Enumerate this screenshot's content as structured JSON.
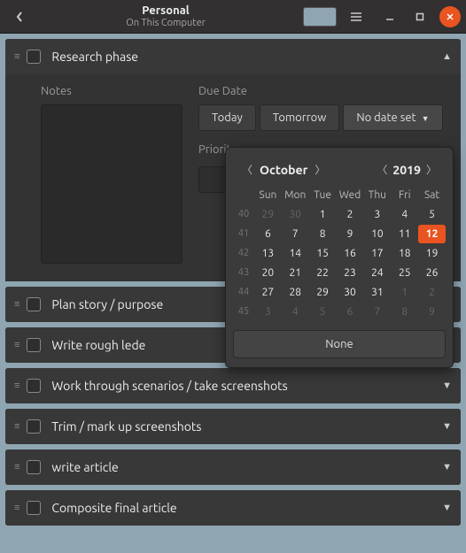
{
  "titlebar": {
    "title": "Personal",
    "subtitle": "On This Computer",
    "color_swatch": "#8fa6b2"
  },
  "expanded_task": {
    "title": "Research phase",
    "notes_label": "Notes",
    "due_label": "Due Date",
    "due_buttons": {
      "today": "Today",
      "tomorrow": "Tomorrow",
      "none": "No date set"
    },
    "priority_label": "Priority"
  },
  "calendar": {
    "month": "October",
    "year": "2019",
    "dow": [
      "Sun",
      "Mon",
      "Tue",
      "Wed",
      "Thu",
      "Fri",
      "Sat"
    ],
    "weeks": [
      {
        "wk": 40,
        "days": [
          {
            "n": 29,
            "out": true
          },
          {
            "n": 30,
            "out": true
          },
          {
            "n": 1
          },
          {
            "n": 2
          },
          {
            "n": 3
          },
          {
            "n": 4
          },
          {
            "n": 5
          }
        ]
      },
      {
        "wk": 41,
        "days": [
          {
            "n": 6
          },
          {
            "n": 7
          },
          {
            "n": 8
          },
          {
            "n": 9
          },
          {
            "n": 10
          },
          {
            "n": 11
          },
          {
            "n": 12,
            "sel": true
          }
        ]
      },
      {
        "wk": 42,
        "days": [
          {
            "n": 13
          },
          {
            "n": 14
          },
          {
            "n": 15
          },
          {
            "n": 16
          },
          {
            "n": 17
          },
          {
            "n": 18
          },
          {
            "n": 19
          }
        ]
      },
      {
        "wk": 43,
        "days": [
          {
            "n": 20
          },
          {
            "n": 21
          },
          {
            "n": 22
          },
          {
            "n": 23
          },
          {
            "n": 24
          },
          {
            "n": 25
          },
          {
            "n": 26
          }
        ]
      },
      {
        "wk": 44,
        "days": [
          {
            "n": 27
          },
          {
            "n": 28
          },
          {
            "n": 29
          },
          {
            "n": 30
          },
          {
            "n": 31
          },
          {
            "n": 1,
            "out": true
          },
          {
            "n": 2,
            "out": true
          }
        ]
      },
      {
        "wk": 45,
        "days": [
          {
            "n": 3,
            "out": true
          },
          {
            "n": 4,
            "out": true
          },
          {
            "n": 5,
            "out": true
          },
          {
            "n": 6,
            "out": true
          },
          {
            "n": 7,
            "out": true
          },
          {
            "n": 8,
            "out": true
          },
          {
            "n": 9,
            "out": true
          }
        ]
      }
    ],
    "none_button": "None"
  },
  "tasks": [
    {
      "title": "Plan story / purpose"
    },
    {
      "title": "Write rough lede"
    },
    {
      "title": "Work through scenarios / take screenshots"
    },
    {
      "title": "Trim / mark up screenshots"
    },
    {
      "title": "write article"
    },
    {
      "title": "Composite final article"
    }
  ]
}
